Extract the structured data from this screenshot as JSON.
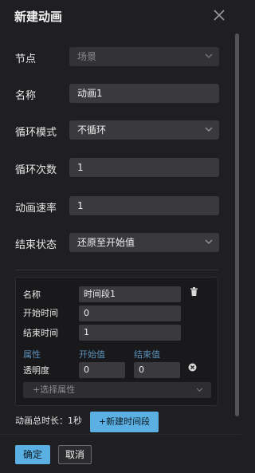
{
  "dialog": {
    "title": "新建动画"
  },
  "form": {
    "node": {
      "label": "节点",
      "value": "场景"
    },
    "name": {
      "label": "名称",
      "value": "动画1"
    },
    "loop_mode": {
      "label": "循环模式",
      "value": "不循环"
    },
    "loop_count": {
      "label": "循环次数",
      "value": "1"
    },
    "speed": {
      "label": "动画速率",
      "value": "1"
    },
    "end_state": {
      "label": "结束状态",
      "value": "还原至开始值"
    }
  },
  "segment": {
    "name_label": "名称",
    "name_value": "时间段1",
    "start_label": "开始时间",
    "start_value": "0",
    "end_label": "结束时间",
    "end_value": "1",
    "col_attr": "属性",
    "col_start": "开始值",
    "col_end": "结束值",
    "attr_name": "透明度",
    "attr_start": "0",
    "attr_end": "0",
    "select_placeholder": "+选择属性"
  },
  "summary": {
    "total_duration": "动画总时长：1秒",
    "add_segment_label": "+新建时间段"
  },
  "footer": {
    "confirm_label": "确定",
    "cancel_label": "取消"
  }
}
